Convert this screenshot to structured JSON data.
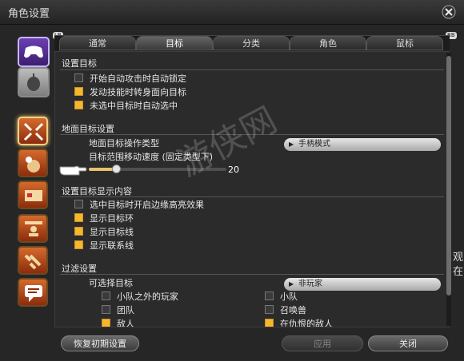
{
  "window": {
    "title": "角色设置"
  },
  "badges": {
    "lb": "LB",
    "rb": "RB"
  },
  "tabs": [
    {
      "label": "通常"
    },
    {
      "label": "目标"
    },
    {
      "label": "分类"
    },
    {
      "label": "角色"
    },
    {
      "label": "鼠标"
    }
  ],
  "sections": {
    "target": {
      "heading": "设置目标",
      "options": [
        {
          "label": "开始自动攻击时自动锁定",
          "checked": false
        },
        {
          "label": "发动技能时转身面向目标",
          "checked": true
        },
        {
          "label": "未选中目标时自动选中",
          "checked": true
        }
      ]
    },
    "ground": {
      "heading": "地面目标设置",
      "op_label": "地面目标操作类型",
      "op_value": "手柄模式",
      "speed_label": "目标范围移动速度 (固定类型下)",
      "speed_value": "20",
      "speed_fraction": 0.2
    },
    "display": {
      "heading": "设置目标显示内容",
      "options": [
        {
          "label": "选中目标时开启边缘高亮效果",
          "checked": false
        },
        {
          "label": "显示目标环",
          "checked": true
        },
        {
          "label": "显示目标线",
          "checked": true
        },
        {
          "label": "显示联系线",
          "checked": true
        }
      ]
    },
    "filter": {
      "heading": "过滤设置",
      "selectable_label": "可选择目标",
      "selectable_value": "非玩家",
      "options": [
        {
          "label": "小队之外的玩家",
          "checked": false
        },
        {
          "label": "小队",
          "checked": false
        },
        {
          "label": "团队",
          "checked": false
        },
        {
          "label": "召唤兽",
          "checked": false
        },
        {
          "label": "敌人",
          "checked": true
        },
        {
          "label": "在仇恨的敌人",
          "checked": true
        }
      ]
    }
  },
  "buttons": {
    "reset": "恢复初期设置",
    "apply": "应用",
    "close": "关闭"
  },
  "watermark": "游侠网",
  "right_edge_text": "观 在",
  "colors": {
    "checked": "#f6b72c",
    "accent": "#e3c36c"
  }
}
